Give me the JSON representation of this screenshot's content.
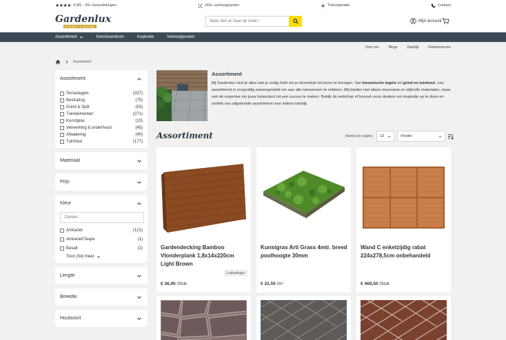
{
  "topbar": {
    "rating": "4.8/5 - 20+ beoordelingen",
    "stores": "160+ verkooppunten",
    "inspiration": "Tuininspiratie",
    "contact": "Contact"
  },
  "header": {
    "logo_name": "Gardenlux",
    "logo_sub": "STONES & PAVING",
    "search_placeholder": "Waar ben je naar op zoek?",
    "account": "Mijn account"
  },
  "nav": [
    "Assortiment",
    "Kenniscentrum",
    "Inspiratie",
    "Verkooppunten"
  ],
  "subnav": [
    "Over ons",
    "Blogs",
    "Zakelijk",
    "Klantenservice"
  ],
  "breadcrumb": "Assortiment",
  "filters": {
    "assortiment": {
      "title": "Assortiment",
      "items": [
        {
          "label": "Terrastegels",
          "count": "(337)"
        },
        {
          "label": "Bestrating",
          "count": "(75)"
        },
        {
          "label": "Grind & Split",
          "count": "(53)"
        },
        {
          "label": "Tuinelementen",
          "count": "(271)"
        },
        {
          "label": "Kunstgras",
          "count": "(10)"
        },
        {
          "label": "Verwerking & onderhoud",
          "count": "(45)"
        },
        {
          "label": "Afwatering",
          "count": "(40)"
        },
        {
          "label": "Tuinhout",
          "count": "(177)"
        }
      ]
    },
    "materiaal": "Materiaal",
    "prijs": "Prijs",
    "kleur": {
      "title": "Kleur",
      "search_placeholder": "Zoeken",
      "items": [
        {
          "label": "Antraciet",
          "count": "(121)"
        },
        {
          "label": "Antraciet/Taupe",
          "count": "(1)"
        },
        {
          "label": "Basalt",
          "count": "(2)"
        }
      ],
      "more": "Toon (54) meer"
    },
    "lengte": "Lengte",
    "breedte": "Breedte",
    "houtsoort": "Houtsoort"
  },
  "intro": {
    "title": "Assortiment",
    "text_1": "Bij Gardenlux vind je alles wat je nodig hebt om je droomtuin tot leven te brengen. Van ",
    "link_1": "keramische tegels",
    "text_2": " tot ",
    "link_2": "grind en tuinhout",
    "text_3": ", ons assortiment is zorgvuldig samengesteld om aan alle tuinwensen te voldoen. Wij bieden niet alleen duurzame en stijlvolle materialen, maar ook de expertise om jouw tuinproject tot een succes te maken. Bekijk de webshop of bezoek onze dealers om inspiratie op te doen en ontdek ons uitgebreide assortiment voor iedere tuinstijl."
  },
  "listing": {
    "heading": "Assortiment",
    "per_page_label": "Aantal per pagina",
    "per_page": "12",
    "sort": "Positie"
  },
  "products": [
    {
      "name": "Gardendecking Bamboo Vlonderplank 1,8x14x220cm Light Brown",
      "price": "€ 36,95",
      "unit": "/Stuk",
      "badge": "2 afmetingen"
    },
    {
      "name": "Kunstgras Arti Grass 4mtr. breed poolhoogte 30mm",
      "price": "€ 32,50",
      "unit": "/m²",
      "badge": ""
    },
    {
      "name": "Wand C enkelzijdig rabat 224x278,5cm onbehandeld",
      "price": "€ 468,50",
      "unit": "/Stuk",
      "badge": ""
    }
  ],
  "colors": {
    "navy": "#3d4a55",
    "accent": "#f7dc0e",
    "gold": "#c9a227"
  }
}
